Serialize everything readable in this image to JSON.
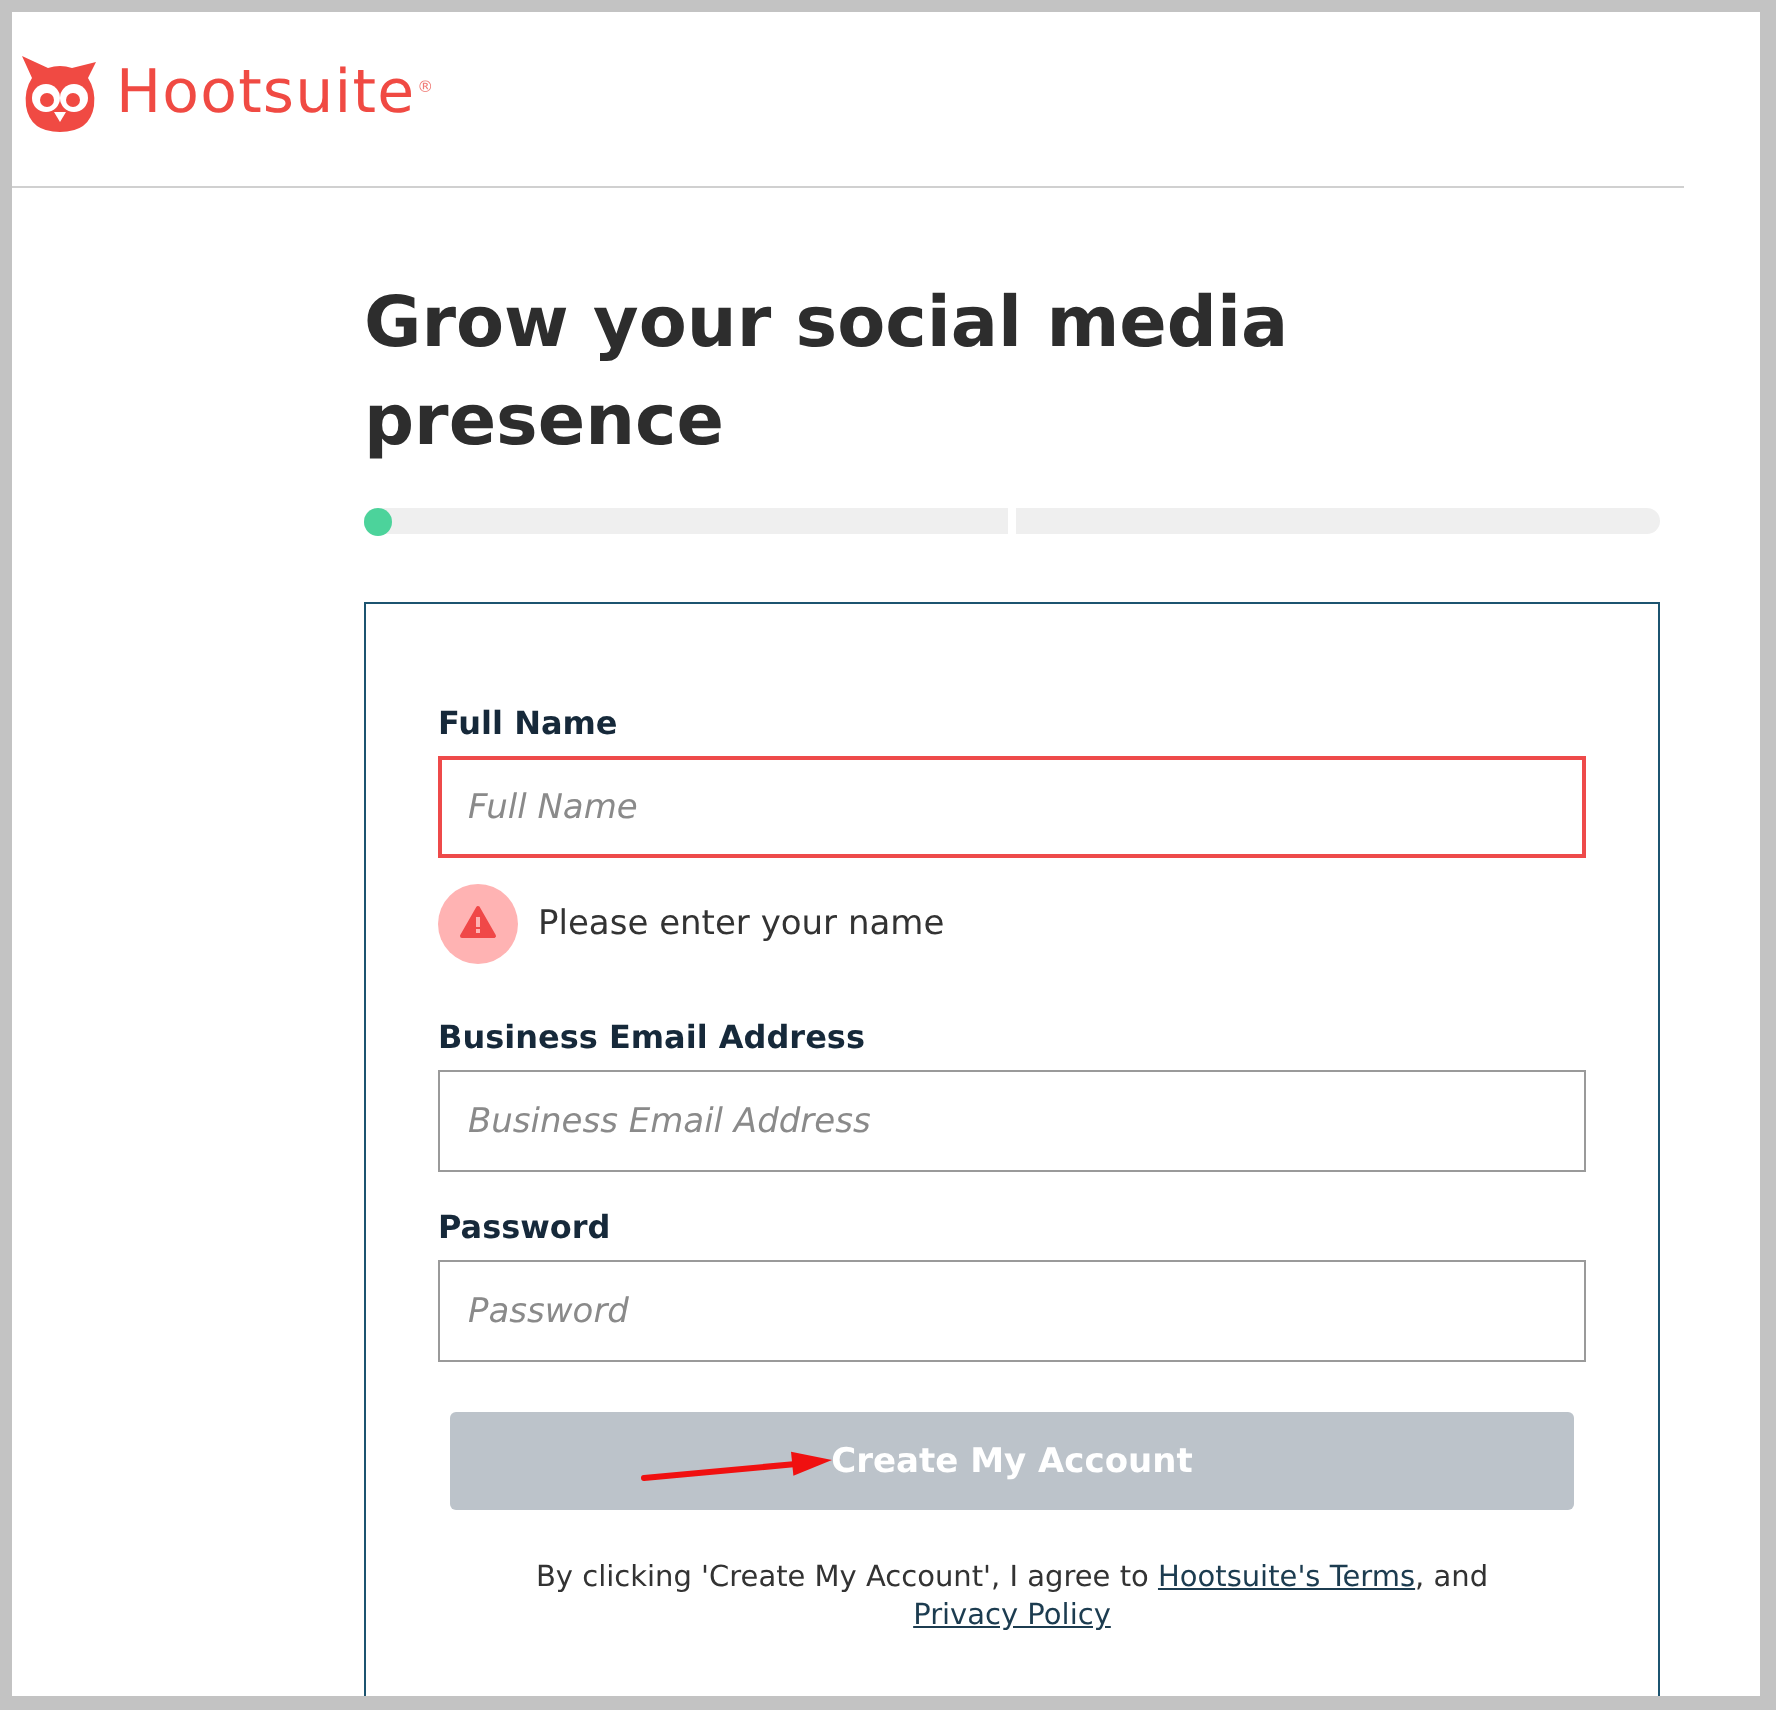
{
  "logo": {
    "text": "Hootsuite",
    "mark": "®"
  },
  "heading": "Grow your social media presence",
  "progress": {
    "steps": [
      {
        "selected": true
      },
      {
        "selected": false
      }
    ]
  },
  "form": {
    "fields": [
      {
        "label": "Full Name",
        "placeholder": "Full Name",
        "invalid": true,
        "error": "Please enter your name"
      },
      {
        "label": "Business Email Address",
        "placeholder": "Business Email Address",
        "invalid": false
      },
      {
        "label": "Password",
        "placeholder": "Password",
        "invalid": false
      }
    ],
    "submit": {
      "label": "Create My Account",
      "disabled": true
    },
    "agreement": [
      {
        "kind": "text",
        "text": "By clicking 'Create My Account', I agree to "
      },
      {
        "kind": "link",
        "text": "Hootsuite's Terms"
      },
      {
        "kind": "text",
        "text": ", and "
      },
      {
        "kind": "link",
        "text": "Privacy Policy"
      }
    ]
  }
}
